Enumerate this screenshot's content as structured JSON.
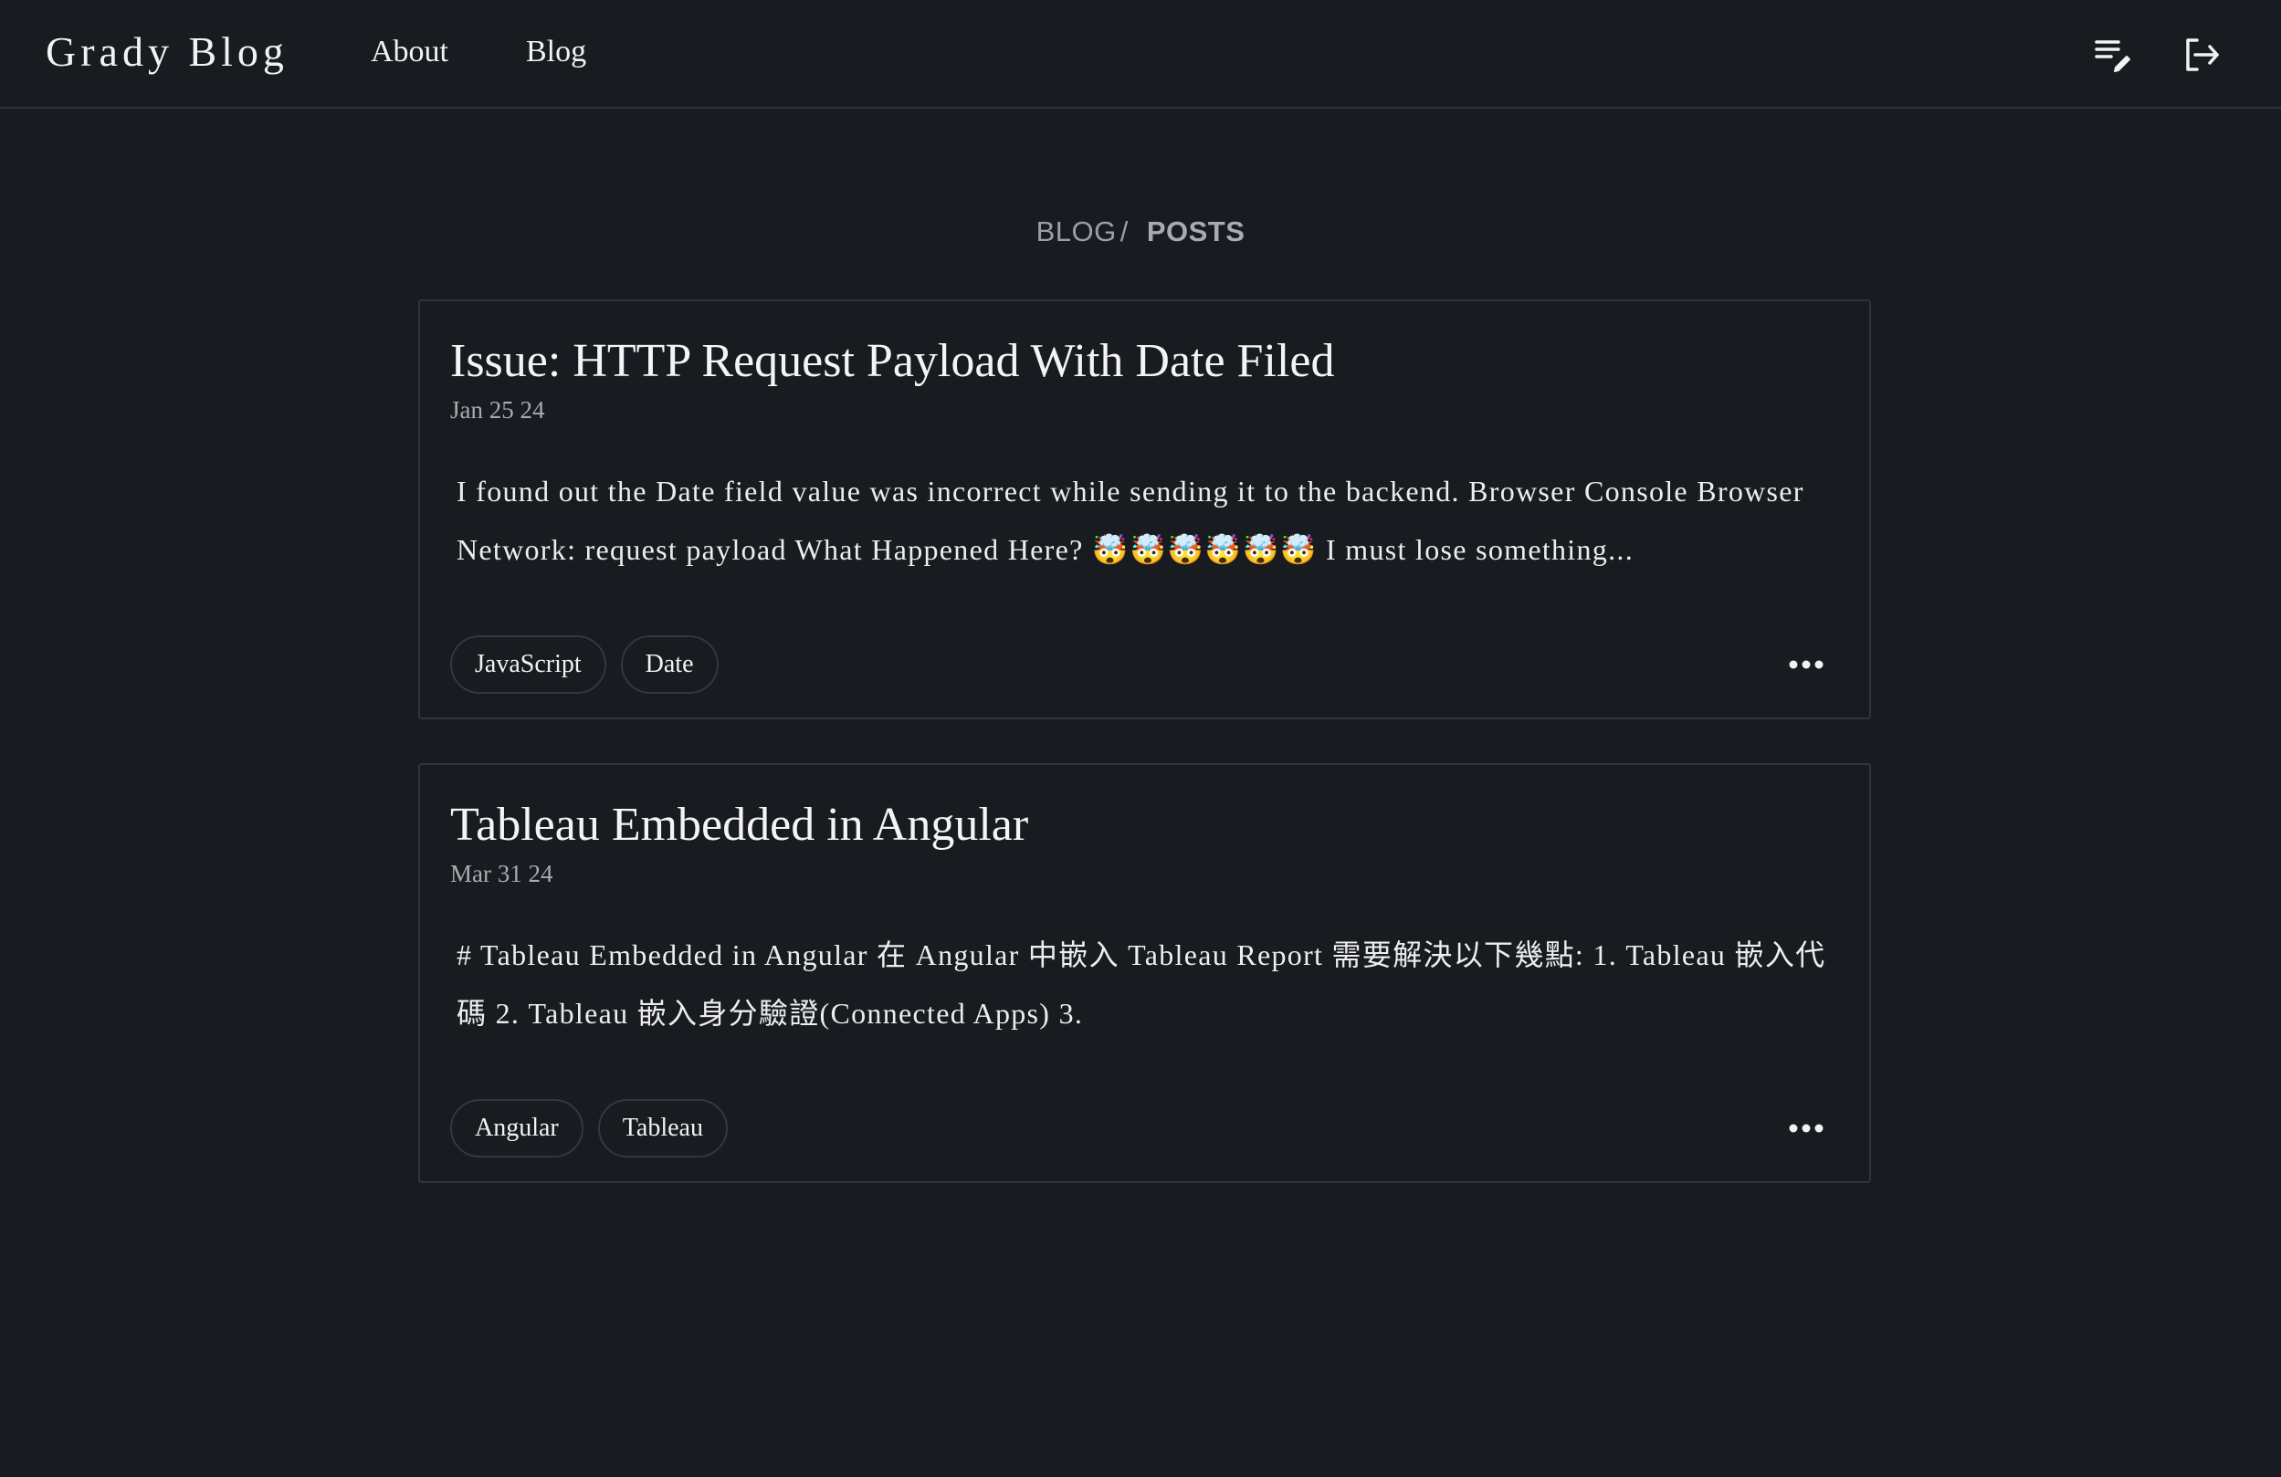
{
  "navbar": {
    "brand": "Grady Blog",
    "links": [
      {
        "label": "About"
      },
      {
        "label": "Blog"
      }
    ],
    "icons": [
      "edit-list-icon",
      "logout-icon"
    ]
  },
  "breadcrumb": {
    "parent": "BLOG",
    "separator": "/",
    "current": "POSTS"
  },
  "posts": [
    {
      "title": "Issue: HTTP Request Payload With Date Filed",
      "date": "Jan 25 24",
      "excerpt": "I found out the Date field value was incorrect while sending it to the backend. Browser Console Browser Network: request payload What Happened Here? 🤯🤯🤯🤯🤯🤯 I must lose something...",
      "tags": [
        "JavaScript",
        "Date"
      ]
    },
    {
      "title": "Tableau Embedded in Angular",
      "date": "Mar 31 24",
      "excerpt": "# Tableau Embedded in Angular 在 Angular 中嵌入 Tableau Report 需要解決以下幾點: 1. Tableau 嵌入代碼 2. Tableau 嵌入身分驗證(Connected Apps) 3.",
      "tags": [
        "Angular",
        "Tableau"
      ]
    }
  ],
  "colors": {
    "background": "#181b20",
    "border": "#31353b",
    "text": "#f2f2f2",
    "muted": "#a8abaf"
  }
}
